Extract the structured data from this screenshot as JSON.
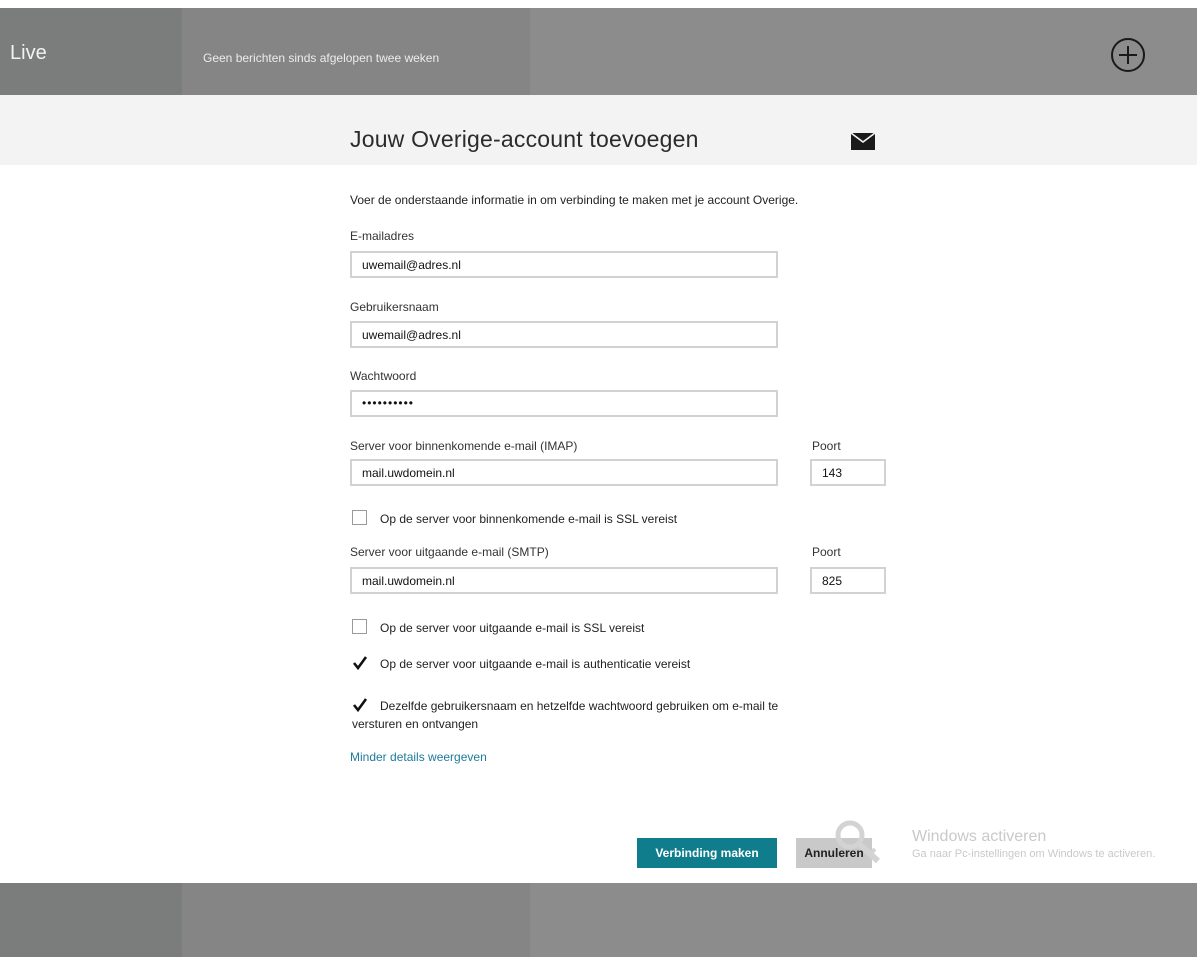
{
  "app": {
    "left_pane_title": "Live",
    "middle_pane_message": "Geen berichten sinds afgelopen twee weken",
    "add_icon": "plus-circle-icon"
  },
  "dialog": {
    "title": "Jouw Overige-account toevoegen",
    "title_icon": "envelope-icon",
    "intro": "Voer de onderstaande informatie in om verbinding te maken met je account Overige.",
    "email": {
      "label": "E-mailadres",
      "value": "uwemail@adres.nl"
    },
    "username": {
      "label": "Gebruikersnaam",
      "value": "uwemail@adres.nl"
    },
    "password": {
      "label": "Wachtwoord",
      "value": "••••••••••"
    },
    "incoming": {
      "label": "Server voor binnenkomende e-mail (IMAP)",
      "value": "mail.uwdomein.nl",
      "port_label": "Poort",
      "port_value": "143",
      "ssl_label": "Op de server voor binnenkomende e-mail is SSL vereist",
      "ssl_checked": false
    },
    "outgoing": {
      "label": "Server voor uitgaande e-mail (SMTP)",
      "value": "mail.uwdomein.nl",
      "port_label": "Poort",
      "port_value": "825",
      "ssl_label": "Op de server voor uitgaande e-mail is SSL vereist",
      "ssl_checked": false,
      "auth_label": "Op de server voor uitgaande e-mail is authenticatie vereist",
      "auth_checked": true
    },
    "same_credentials": {
      "line1": "Dezelfde gebruikersnaam en hetzelfde wachtwoord gebruiken om e-mail te",
      "line2": "versturen en ontvangen",
      "checked": true
    },
    "less_details_link": "Minder details weergeven",
    "connect_button": "Verbinding maken",
    "cancel_button": "Annuleren"
  },
  "watermark": {
    "title": "Windows activeren",
    "text": "Ga naar Pc-instellingen om Windows te activeren."
  },
  "colors": {
    "accent": "#0f7d8c",
    "link": "#1e7b9c"
  }
}
